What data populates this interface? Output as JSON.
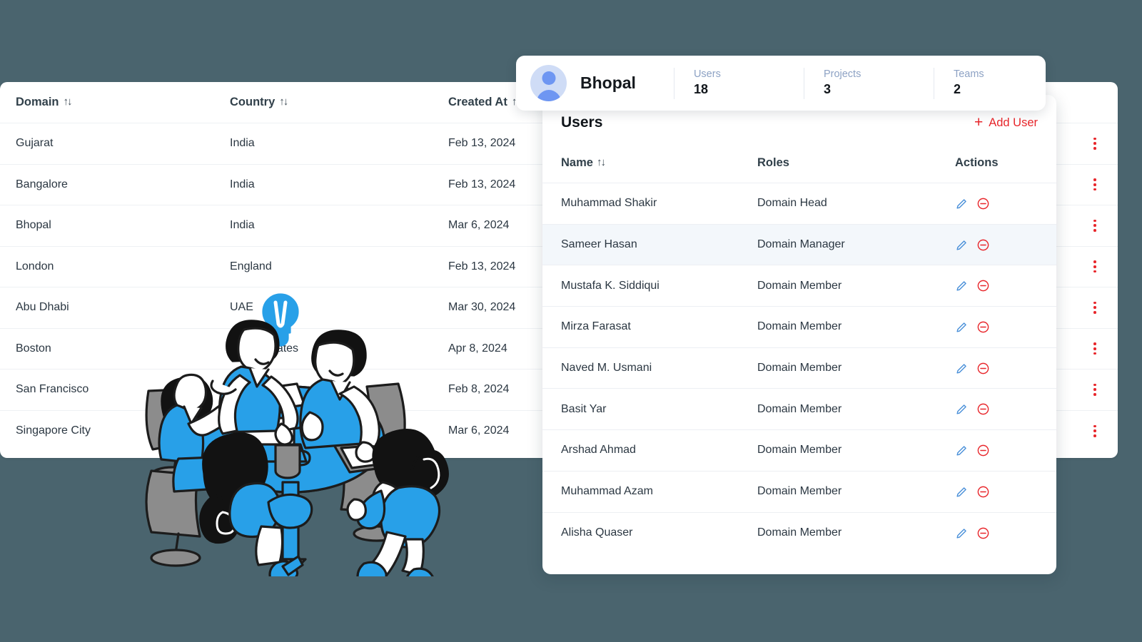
{
  "colors": {
    "page_background": "#4a646e",
    "accent_red": "#e8262b",
    "accent_blue": "#4a90d9",
    "avatar_bg": "#cfdcf6",
    "avatar_fg": "#6e96f2",
    "selected_row": "#f3f7fb"
  },
  "domain_table": {
    "columns": [
      {
        "label": "Domain",
        "sortable": true,
        "sort_icon": "↑↓"
      },
      {
        "label": "Country",
        "sortable": true,
        "sort_icon": "↑↓"
      },
      {
        "label": "Created At",
        "sortable": true,
        "sort_icon": "↑↓"
      }
    ],
    "rows": [
      {
        "domain": "Gujarat",
        "country": "India",
        "created_at": "Feb 13, 2024"
      },
      {
        "domain": "Bangalore",
        "country": "India",
        "created_at": "Feb 13, 2024"
      },
      {
        "domain": "Bhopal",
        "country": "India",
        "created_at": "Mar 6, 2024"
      },
      {
        "domain": "London",
        "country": "England",
        "created_at": "Feb 13, 2024"
      },
      {
        "domain": "Abu Dhabi",
        "country": "UAE",
        "created_at": "Mar 30, 2024"
      },
      {
        "domain": "Boston",
        "country": "United States",
        "created_at": "Apr 8, 2024"
      },
      {
        "domain": "San Francisco",
        "country": "",
        "created_at": "Feb 8, 2024"
      },
      {
        "domain": "Singapore City",
        "country": "",
        "created_at": "Mar 6, 2024"
      }
    ],
    "row_menu_icon": "kebab-menu"
  },
  "stat_card": {
    "avatar_icon": "user-avatar",
    "domain_name": "Bhopal",
    "stats": [
      {
        "label": "Users",
        "value": "18"
      },
      {
        "label": "Projects",
        "value": "3"
      },
      {
        "label": "Teams",
        "value": "2"
      }
    ]
  },
  "users_panel": {
    "title": "Users",
    "add_button": {
      "label": "Add User",
      "icon": "plus-icon"
    },
    "columns": [
      {
        "label": "Name",
        "sortable": true,
        "sort_icon": "↑↓"
      },
      {
        "label": "Roles",
        "sortable": false
      },
      {
        "label": "Actions",
        "sortable": false
      }
    ],
    "rows": [
      {
        "name": "Muhammad Shakir",
        "role": "Domain Head",
        "selected": false
      },
      {
        "name": "Sameer Hasan",
        "role": "Domain Manager",
        "selected": true
      },
      {
        "name": "Mustafa K. Siddiqui",
        "role": "Domain Member",
        "selected": false
      },
      {
        "name": "Mirza Farasat",
        "role": "Domain Member",
        "selected": false
      },
      {
        "name": "Naved M. Usmani",
        "role": "Domain Member",
        "selected": false
      },
      {
        "name": "Basit Yar",
        "role": "Domain Member",
        "selected": false
      },
      {
        "name": "Arshad Ahmad",
        "role": "Domain Member",
        "selected": false
      },
      {
        "name": "Muhammad Azam",
        "role": "Domain Member",
        "selected": false
      },
      {
        "name": "Alisha Quaser",
        "role": "Domain Member",
        "selected": false
      }
    ],
    "row_actions": [
      {
        "icon": "edit-pencil-icon"
      },
      {
        "icon": "remove-circle-icon"
      }
    ]
  },
  "illustration": {
    "name": "team-meeting-illustration",
    "description": "Five colleagues seated around a round table with a lightbulb above"
  }
}
